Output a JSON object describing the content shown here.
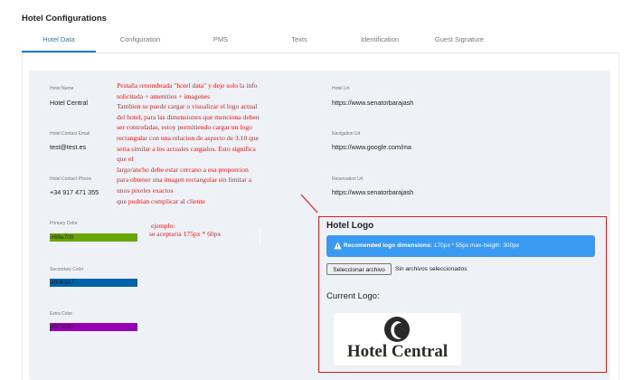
{
  "page_title": "Hotel Configurations",
  "tabs": [
    {
      "label": "Hotel Data",
      "active": true
    },
    {
      "label": "Configuration",
      "active": false
    },
    {
      "label": "PMS",
      "active": false
    },
    {
      "label": "Texts",
      "active": false
    },
    {
      "label": "Identification",
      "active": false
    },
    {
      "label": "Guest Signature",
      "active": false
    }
  ],
  "fields": {
    "hotel_name": {
      "label": "Hotel Name",
      "value": "Hotel Central"
    },
    "contact_email": {
      "label": "Hotel Contact Email",
      "value": "test@test.es"
    },
    "contact_phone": {
      "label": "Hotel Contact Phone",
      "value": "+34 917 471 355"
    },
    "hotel_url": {
      "label": "Hotel Url",
      "value": "https://www.senatorbarajash"
    },
    "navigation_url": {
      "label": "Navigation Url",
      "value": "https://www.google.com/ma"
    },
    "reservation_url": {
      "label": "Reservation Url",
      "value": "https://www.senatorbarajash"
    }
  },
  "colors": {
    "primary": {
      "label": "Primary Color",
      "value": "#69a700"
    },
    "secondary": {
      "label": "Secondary Color",
      "value": "#0063A7"
    },
    "extra": {
      "label": "Extra Color",
      "value": "#9700B2"
    }
  },
  "annotation": {
    "lines": [
      "Pestaña renombrada \"hotel data\" y deje solo la info",
      "solicitada + amenities + imagenes",
      "Tambien se puede cargar o visualizar el logo actual",
      "del hotel, para las dimensiones que menciona deben",
      "ser controladas, estoy permitiendo cargar un logo",
      "rectangular con una relacion de aspecto de 3.10 que",
      "seria similar a los actuales cargados. Esto significa",
      "que el",
      "largo/ancho debe estar cercano a esa proporcion",
      "para obtener una imagen rectangular sin limitar a",
      "unos pixeles exactos",
      "que podrian complicar al cliente"
    ],
    "example_label": "ejemplo:",
    "example_text": "se aceptaria 175px * 60px"
  },
  "logo_section": {
    "title": "Hotel Logo",
    "alert_icon": "warning-triangle-icon",
    "alert_strong": "Recomended logo dimensions:",
    "alert_text": " 170px * 55px max-heigth: 300px",
    "file_button": "Seleccionar archivo",
    "file_status": "Sin archivos seleccionados",
    "current_label": "Current Logo:",
    "logo_text": "Hotel Central"
  },
  "accent_color": "#1e7fc8",
  "alert_color": "#3a99f0",
  "annotation_color": "#e02020"
}
